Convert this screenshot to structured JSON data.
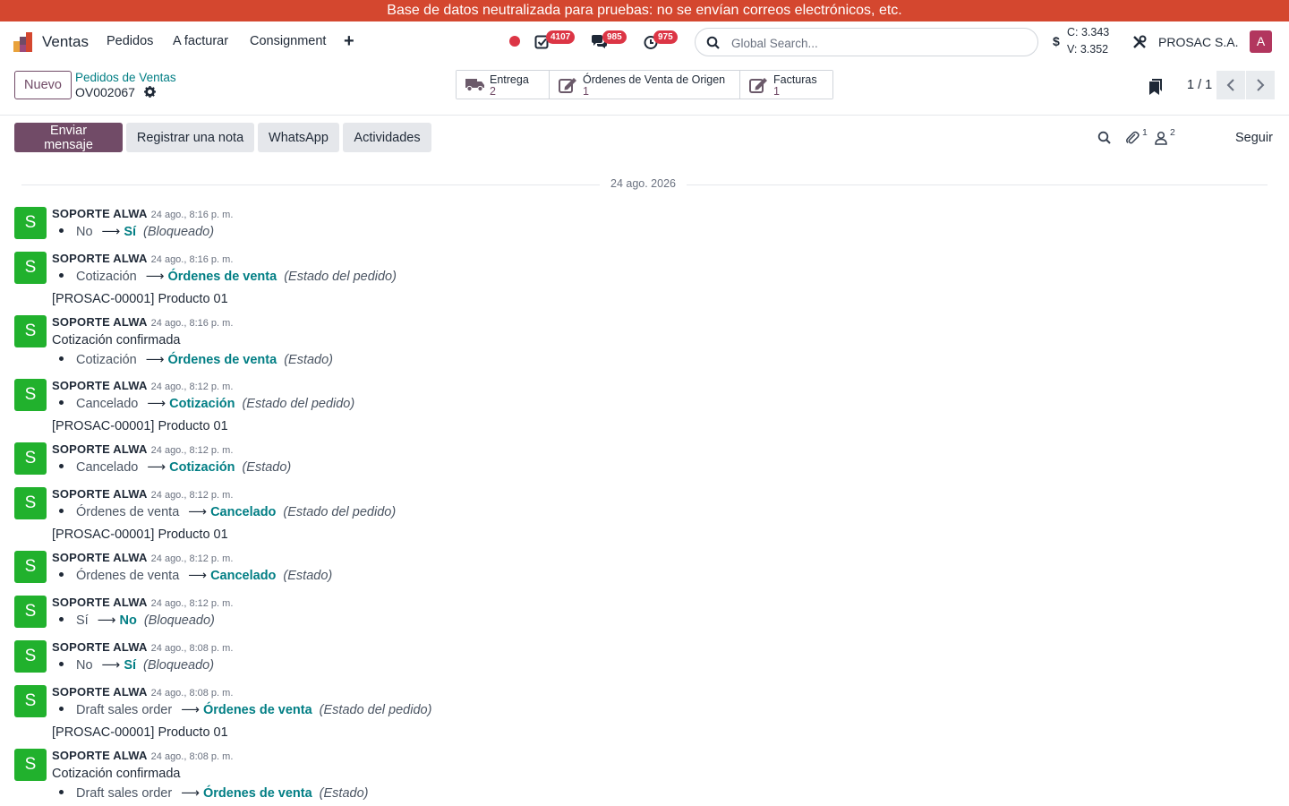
{
  "banner": "Base de datos neutralizada para pruebas: no se envían correos electrónicos, etc.",
  "navbar": {
    "app_name": "Ventas",
    "menu": [
      "Pedidos",
      "A facturar",
      "Consignment"
    ],
    "plus": "+",
    "badges": {
      "activities": "4107",
      "messages": "985",
      "timers": "975"
    },
    "search_placeholder": "Global Search...",
    "currency_symbol": "$",
    "rate_c": "C: 3.343",
    "rate_v": "V: 3.352",
    "company": "PROSAC S.A.",
    "user_initial": "A",
    "colors": {
      "banner": "#d4472f",
      "primary": "#714b67",
      "badge": "#dc3545"
    }
  },
  "control": {
    "new_button": "Nuevo",
    "breadcrumb_link": "Pedidos de Ventas",
    "record_name": "OV002067",
    "smart_buttons": [
      {
        "label": "Entrega",
        "count": "2",
        "icon": "truck-icon"
      },
      {
        "label": "Órdenes de Venta de Origen",
        "count": "1",
        "icon": "edit-icon"
      },
      {
        "label": "Facturas",
        "count": "1",
        "icon": "edit-icon"
      }
    ],
    "pager": "1 / 1"
  },
  "chatter": {
    "buttons": {
      "send": "Enviar mensaje",
      "note": "Registrar una nota",
      "whatsapp": "WhatsApp",
      "activities": "Actividades"
    },
    "attachments_count": "1",
    "followers_count": "2",
    "follow_label": "Seguir",
    "date": "24 ago. 2026",
    "messages": [
      {
        "initial": "S",
        "author": "SOPORTE ALWA",
        "time": "24 ago., 8:16 p. m.",
        "body": "",
        "old": "No",
        "new": "Sí",
        "field": "(Bloqueado)",
        "product": ""
      },
      {
        "initial": "S",
        "author": "SOPORTE ALWA",
        "time": "24 ago., 8:16 p. m.",
        "body": "",
        "old": "Cotización",
        "new": "Órdenes de venta",
        "field": "(Estado del pedido)",
        "product": "[PROSAC-00001] Producto 01"
      },
      {
        "initial": "S",
        "author": "SOPORTE ALWA",
        "time": "24 ago., 8:16 p. m.",
        "body": "Cotización confirmada",
        "old": "Cotización",
        "new": "Órdenes de venta",
        "field": "(Estado)",
        "product": ""
      },
      {
        "initial": "S",
        "author": "SOPORTE ALWA",
        "time": "24 ago., 8:12 p. m.",
        "body": "",
        "old": "Cancelado",
        "new": "Cotización",
        "field": "(Estado del pedido)",
        "product": "[PROSAC-00001] Producto 01"
      },
      {
        "initial": "S",
        "author": "SOPORTE ALWA",
        "time": "24 ago., 8:12 p. m.",
        "body": "",
        "old": "Cancelado",
        "new": "Cotización",
        "field": "(Estado)",
        "product": ""
      },
      {
        "initial": "S",
        "author": "SOPORTE ALWA",
        "time": "24 ago., 8:12 p. m.",
        "body": "",
        "old": "Órdenes de venta",
        "new": "Cancelado",
        "field": "(Estado del pedido)",
        "product": "[PROSAC-00001] Producto 01"
      },
      {
        "initial": "S",
        "author": "SOPORTE ALWA",
        "time": "24 ago., 8:12 p. m.",
        "body": "",
        "old": "Órdenes de venta",
        "new": "Cancelado",
        "field": "(Estado)",
        "product": ""
      },
      {
        "initial": "S",
        "author": "SOPORTE ALWA",
        "time": "24 ago., 8:12 p. m.",
        "body": "",
        "old": "Sí",
        "new": "No",
        "field": "(Bloqueado)",
        "product": ""
      },
      {
        "initial": "S",
        "author": "SOPORTE ALWA",
        "time": "24 ago., 8:08 p. m.",
        "body": "",
        "old": "No",
        "new": "Sí",
        "field": "(Bloqueado)",
        "product": ""
      },
      {
        "initial": "S",
        "author": "SOPORTE ALWA",
        "time": "24 ago., 8:08 p. m.",
        "body": "",
        "old": "Draft sales order",
        "new": "Órdenes de venta",
        "field": "(Estado del pedido)",
        "product": "[PROSAC-00001] Producto 01"
      },
      {
        "initial": "S",
        "author": "SOPORTE ALWA",
        "time": "24 ago., 8:08 p. m.",
        "body": "Cotización confirmada",
        "old": "Draft sales order",
        "new": "Órdenes de venta",
        "field": "(Estado)",
        "product": ""
      }
    ]
  }
}
